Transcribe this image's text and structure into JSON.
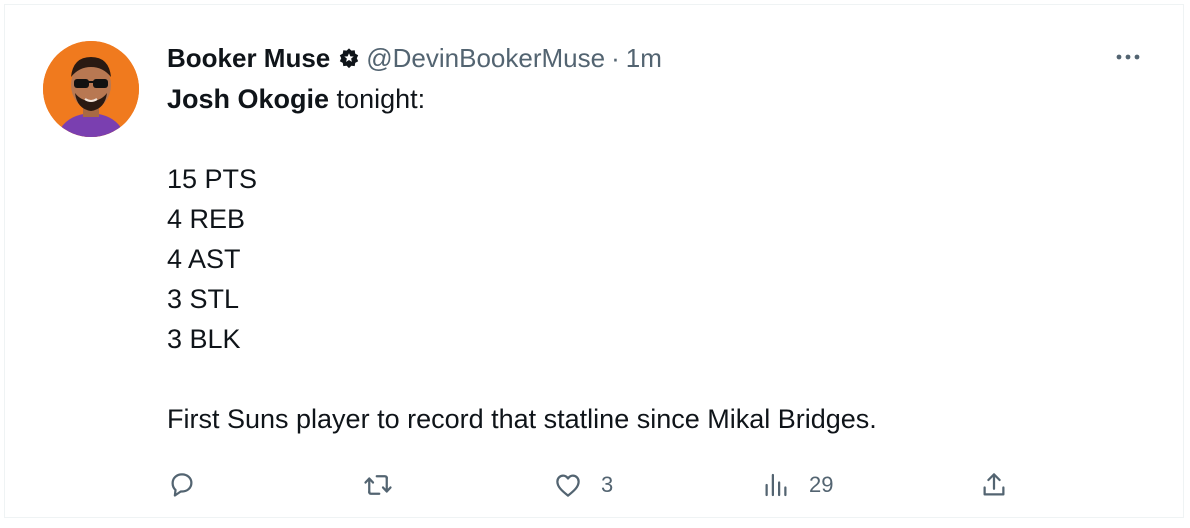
{
  "author": {
    "display_name": "Booker Muse",
    "handle": "@DevinBookerMuse",
    "separator": "·",
    "time": "1m",
    "avatar_icon": "cartoon-avatar-with-sunglasses",
    "badge_icon": "verified-badge-icon"
  },
  "tweet": {
    "mention": "Josh Okogie",
    "intro_suffix": " tonight:",
    "stats": [
      "15 PTS",
      "4 REB",
      "4 AST",
      "3 STL",
      "3 BLK"
    ],
    "closing": "First Suns player to record that statline since Mikal Bridges."
  },
  "menu": {
    "more_icon": "more-options-icon",
    "more_label": "···"
  },
  "actions": {
    "reply": {
      "icon": "reply-icon",
      "count": ""
    },
    "retweet": {
      "icon": "retweet-icon",
      "count": ""
    },
    "like": {
      "icon": "heart-icon",
      "count": "3"
    },
    "views": {
      "icon": "analytics-icon",
      "count": "29"
    },
    "share": {
      "icon": "share-icon",
      "count": ""
    }
  },
  "colors": {
    "text_primary": "#0f1419",
    "text_secondary": "#536471",
    "avatar_bg": "#f07a1e"
  }
}
